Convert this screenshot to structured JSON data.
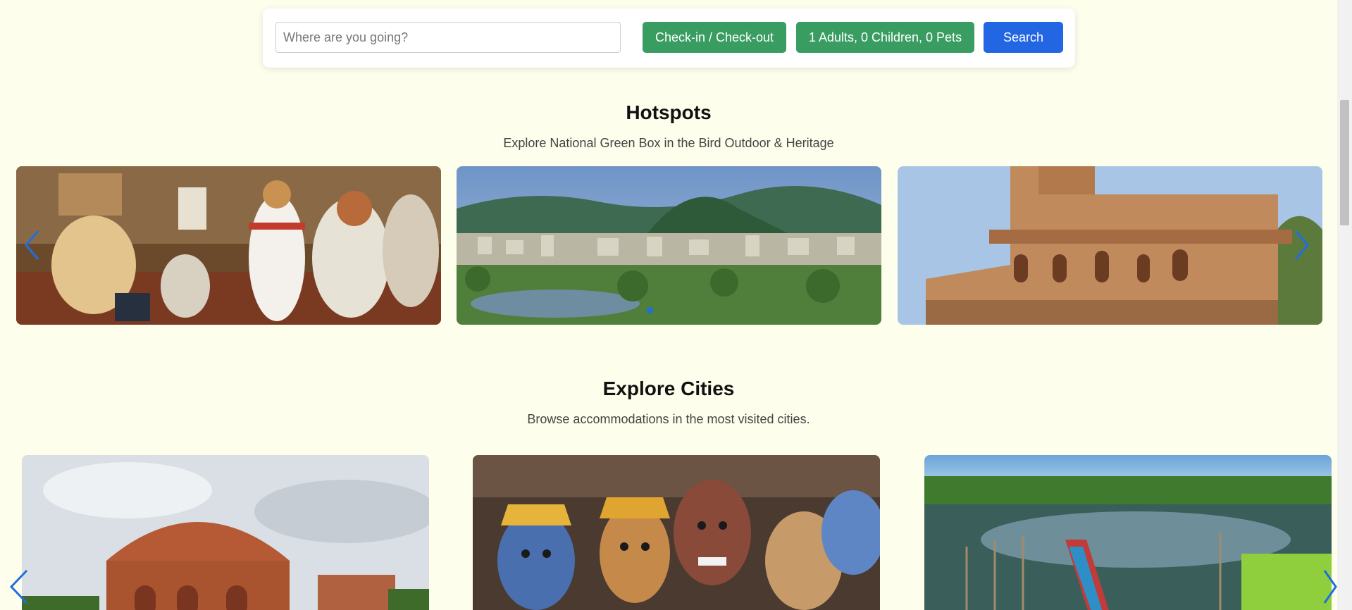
{
  "search": {
    "placeholder": "Where are you going?",
    "dates_label": "Check-in / Check-out",
    "guests_label": "1 Adults, 0 Children, 0 Pets",
    "search_label": "Search"
  },
  "hotspots": {
    "title": "Hotspots",
    "subtitle": "Explore National Green Box in the Bird Outdoor & Heritage"
  },
  "explore": {
    "title": "Explore Cities",
    "subtitle": "Browse accommodations in the most visited cities."
  },
  "colors": {
    "background": "#fefeec",
    "green_button": "#399d61",
    "blue_button": "#2266e3",
    "arrow": "#1e6fe0"
  }
}
